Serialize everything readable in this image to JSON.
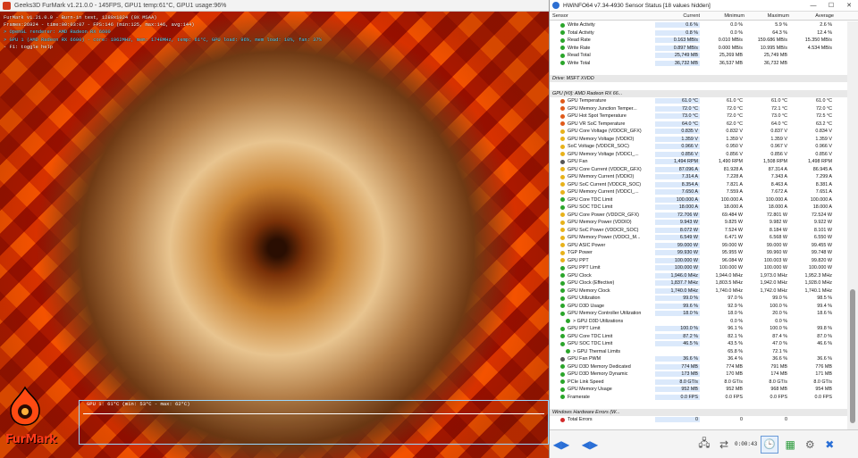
{
  "furmark": {
    "window_title": "Geeks3D FurMark v1.21.0.0 - 145FPS, GPU1 temp:61°C, GPU1 usage:96%",
    "osd": [
      {
        "text": "FurMark v1.21.0.0 - Burn-in test, 1280x1024 (0X MSAA)",
        "cls": "l-white"
      },
      {
        "text": "Frames:26924 - time:00:03:07 - FPS:146 (min:125, max:146, avg:144)",
        "cls": "l-white"
      },
      {
        "text": "> OpenGL renderer: AMD Radeon RX 6600",
        "cls": "l-cyan"
      },
      {
        "text": "> GPU 1 (AMD Radeon RX 6600) - core: 1962MHz, mem: 1748MHz, temp: 61°C, GPU load: 96%, mem load: 10%, fan: 37%",
        "cls": "l-cyan"
      },
      {
        "text": "- F1: toggle help",
        "cls": "l-white"
      }
    ],
    "graph_caption": "GPU 1: 61°C (min: 53°C - max: 62°C)",
    "logo_text": "FurMark"
  },
  "hwinfo": {
    "window_title": "HWiNFO64 v7.34-4930 Sensor Status [18 values hidden]",
    "columns": {
      "sensor": "Sensor",
      "current": "Current",
      "minimum": "Minimum",
      "maximum": "Maximum",
      "average": "Average"
    },
    "rows": [
      {
        "type": "sensor",
        "icon": "#2aa52a",
        "name": "Write Activity",
        "cur": "0.6 %",
        "min": "0.0 %",
        "max": "5.9 %",
        "avg": "2.6 %"
      },
      {
        "type": "sensor",
        "icon": "#2aa52a",
        "name": "Total Activity",
        "cur": "0.8 %",
        "min": "0.0 %",
        "max": "64.3 %",
        "avg": "12.4 %"
      },
      {
        "type": "sensor",
        "icon": "#2aa52a",
        "name": "Read Rate",
        "cur": "0.163 MB/s",
        "min": "0.010 MB/s",
        "max": "159.686 MB/s",
        "avg": "15.350 MB/s"
      },
      {
        "type": "sensor",
        "icon": "#2aa52a",
        "name": "Write Rate",
        "cur": "0.897 MB/s",
        "min": "0.000 MB/s",
        "max": "10.995 MB/s",
        "avg": "4.534 MB/s"
      },
      {
        "type": "sensor",
        "icon": "#2aa52a",
        "name": "Read Total",
        "cur": "25,749 MB",
        "min": "25,269 MB",
        "max": "25,749 MB",
        "avg": ""
      },
      {
        "type": "sensor",
        "icon": "#2aa52a",
        "name": "Write Total",
        "cur": "36,732 MB",
        "min": "36,537 MB",
        "max": "36,732 MB",
        "avg": ""
      },
      {
        "type": "spacer"
      },
      {
        "type": "group",
        "name": "Drive: MSFT XVDD"
      },
      {
        "type": "spacer"
      },
      {
        "type": "group",
        "name": "GPU [#0]: AMD Radeon RX 66..."
      },
      {
        "type": "sensor",
        "icon": "#e05a1a",
        "name": "GPU Temperature",
        "cur": "61.0 °C",
        "min": "61.0 °C",
        "max": "61.0 °C",
        "avg": "61.0 °C"
      },
      {
        "type": "sensor",
        "icon": "#e05a1a",
        "name": "GPU Memory Junction Temper...",
        "cur": "72.0 °C",
        "min": "72.0 °C",
        "max": "72.1 °C",
        "avg": "72.0 °C"
      },
      {
        "type": "sensor",
        "icon": "#e05a1a",
        "name": "GPU Hot Spot Temperature",
        "cur": "73.0 °C",
        "min": "72.0 °C",
        "max": "73.0 °C",
        "avg": "72.5 °C"
      },
      {
        "type": "sensor",
        "icon": "#e05a1a",
        "name": "GPU VR SoC Temperature",
        "cur": "64.0 °C",
        "min": "62.0 °C",
        "max": "64.0 °C",
        "avg": "63.2 °C"
      },
      {
        "type": "sensor",
        "icon": "#e8b21a",
        "name": "GPU Core Voltage (VDDCR_GFX)",
        "cur": "0.835 V",
        "min": "0.832 V",
        "max": "0.837 V",
        "avg": "0.834 V"
      },
      {
        "type": "sensor",
        "icon": "#e8b21a",
        "name": "GPU Memory Voltage (VDDIO)",
        "cur": "1.359 V",
        "min": "1.359 V",
        "max": "1.359 V",
        "avg": "1.359 V"
      },
      {
        "type": "sensor",
        "icon": "#e8b21a",
        "name": "SoC Voltage (VDDCR_SOC)",
        "cur": "0.966 V",
        "min": "0.950 V",
        "max": "0.967 V",
        "avg": "0.966 V"
      },
      {
        "type": "sensor",
        "icon": "#e8b21a",
        "name": "GPU Memory Voltage (VDDCI_...",
        "cur": "0.856 V",
        "min": "0.856 V",
        "max": "0.856 V",
        "avg": "0.856 V"
      },
      {
        "type": "sensor",
        "icon": "#555555",
        "name": "GPU Fan",
        "cur": "1,494 RPM",
        "min": "1,490 RPM",
        "max": "1,508 RPM",
        "avg": "1,498 RPM"
      },
      {
        "type": "sensor",
        "icon": "#e8b21a",
        "name": "GPU Core Current (VDDCR_GFX)",
        "cur": "87.096 A",
        "min": "81.928 A",
        "max": "87.314 A",
        "avg": "86.945 A"
      },
      {
        "type": "sensor",
        "icon": "#e8b21a",
        "name": "GPU Memory Current (VDDIO)",
        "cur": "7.314 A",
        "min": "7.228 A",
        "max": "7.343 A",
        "avg": "7.299 A"
      },
      {
        "type": "sensor",
        "icon": "#e8b21a",
        "name": "GPU SoC Current (VDDCR_SOC)",
        "cur": "8.354 A",
        "min": "7.821 A",
        "max": "8.463 A",
        "avg": "8.381 A"
      },
      {
        "type": "sensor",
        "icon": "#e8b21a",
        "name": "GPU Memory Current (VDDCI_...",
        "cur": "7.650 A",
        "min": "7.559 A",
        "max": "7.672 A",
        "avg": "7.651 A"
      },
      {
        "type": "sensor",
        "icon": "#2aa52a",
        "name": "GPU Core TDC Limit",
        "cur": "100.000 A",
        "min": "100.000 A",
        "max": "100.000 A",
        "avg": "100.000 A"
      },
      {
        "type": "sensor",
        "icon": "#2aa52a",
        "name": "GPU SOC TDC Limit",
        "cur": "18.000 A",
        "min": "18.000 A",
        "max": "18.000 A",
        "avg": "18.000 A"
      },
      {
        "type": "sensor",
        "icon": "#e8b21a",
        "name": "GPU Core Power (VDDCR_GFX)",
        "cur": "72.706 W",
        "min": "69.484 W",
        "max": "72.801 W",
        "avg": "72.524 W"
      },
      {
        "type": "sensor",
        "icon": "#e8b21a",
        "name": "GPU Memory Power (VDDIO)",
        "cur": "9.943 W",
        "min": "9.825 W",
        "max": "9.982 W",
        "avg": "9.922 W"
      },
      {
        "type": "sensor",
        "icon": "#e8b21a",
        "name": "GPU SoC Power (VDDCR_SOC)",
        "cur": "8.072 W",
        "min": "7.524 W",
        "max": "8.184 W",
        "avg": "8.101 W"
      },
      {
        "type": "sensor",
        "icon": "#e8b21a",
        "name": "GPU Memory Power (VDDCI_M...",
        "cur": "6.549 W",
        "min": "6.471 W",
        "max": "6.568 W",
        "avg": "6.550 W"
      },
      {
        "type": "sensor",
        "icon": "#e8b21a",
        "name": "GPU ASIC Power",
        "cur": "99.000 W",
        "min": "99.000 W",
        "max": "99.000 W",
        "avg": "99.455 W"
      },
      {
        "type": "sensor",
        "icon": "#e8b21a",
        "name": "TGP Power",
        "cur": "99.930 W",
        "min": "95.955 W",
        "max": "99.960 W",
        "avg": "99.748 W"
      },
      {
        "type": "sensor",
        "icon": "#e8b21a",
        "name": "GPU PPT",
        "cur": "100.000 W",
        "min": "96.084 W",
        "max": "100.003 W",
        "avg": "99.820 W"
      },
      {
        "type": "sensor",
        "icon": "#2aa52a",
        "name": "GPU PPT Limit",
        "cur": "100.000 W",
        "min": "100.000 W",
        "max": "100.000 W",
        "avg": "100.000 W"
      },
      {
        "type": "sensor",
        "icon": "#2aa52a",
        "name": "GPU Clock",
        "cur": "1,946.0 MHz",
        "min": "1,944.0 MHz",
        "max": "1,973.0 MHz",
        "avg": "1,952.3 MHz"
      },
      {
        "type": "sensor",
        "icon": "#2aa52a",
        "name": "GPU Clock (Effective)",
        "cur": "1,837.7 MHz",
        "min": "1,803.5 MHz",
        "max": "1,942.0 MHz",
        "avg": "1,928.0 MHz"
      },
      {
        "type": "sensor",
        "icon": "#2aa52a",
        "name": "GPU Memory Clock",
        "cur": "1,740.0 MHz",
        "min": "1,740.0 MHz",
        "max": "1,742.0 MHz",
        "avg": "1,740.1 MHz"
      },
      {
        "type": "sensor",
        "icon": "#2aa52a",
        "name": "GPU Utilization",
        "cur": "99.0 %",
        "min": "97.0 %",
        "max": "99.0 %",
        "avg": "98.5 %"
      },
      {
        "type": "sensor",
        "icon": "#2aa52a",
        "name": "GPU D3D Usage",
        "cur": "99.6 %",
        "min": "92.9 %",
        "max": "100.0 %",
        "avg": "99.4 %"
      },
      {
        "type": "sensor",
        "icon": "#2aa52a",
        "name": "GPU Memory Controller Utilization",
        "cur": "18.0 %",
        "min": "18.0 %",
        "max": "20.0 %",
        "avg": "18.6 %"
      },
      {
        "type": "sensor",
        "sub": true,
        "icon": "#2aa52a",
        "name": "> GPU D3D Utilizations",
        "cur": "",
        "min": "0.0 %",
        "max": "0.0 %",
        "avg": ""
      },
      {
        "type": "sensor",
        "icon": "#2aa52a",
        "name": "GPU PPT Limit",
        "cur": "100.0 %",
        "min": "96.1 %",
        "max": "100.0 %",
        "avg": "99.8 %"
      },
      {
        "type": "sensor",
        "icon": "#2aa52a",
        "name": "GPU Core TDC Limit",
        "cur": "87.2 %",
        "min": "82.1 %",
        "max": "87.4 %",
        "avg": "87.0 %"
      },
      {
        "type": "sensor",
        "icon": "#2aa52a",
        "name": "GPU SOC TDC Limit",
        "cur": "46.5 %",
        "min": "43.5 %",
        "max": "47.0 %",
        "avg": "46.6 %"
      },
      {
        "type": "sensor",
        "sub": true,
        "icon": "#2aa52a",
        "name": "> GPU Thermal Limits",
        "cur": "",
        "min": "65.8 %",
        "max": "72.1 %",
        "avg": ""
      },
      {
        "type": "sensor",
        "icon": "#555555",
        "name": "GPU Fan PWM",
        "cur": "36.6 %",
        "min": "36.4 %",
        "max": "36.6 %",
        "avg": "36.6 %"
      },
      {
        "type": "sensor",
        "icon": "#2aa52a",
        "name": "GPU D3D Memory Dedicated",
        "cur": "774 MB",
        "min": "774 MB",
        "max": "791 MB",
        "avg": "776 MB"
      },
      {
        "type": "sensor",
        "icon": "#2aa52a",
        "name": "GPU D3D Memory Dynamic",
        "cur": "173 MB",
        "min": "170 MB",
        "max": "174 MB",
        "avg": "171 MB"
      },
      {
        "type": "sensor",
        "icon": "#2aa52a",
        "name": "PCIe Link Speed",
        "cur": "8.0 GT/s",
        "min": "8.0 GT/s",
        "max": "8.0 GT/s",
        "avg": "8.0 GT/s"
      },
      {
        "type": "sensor",
        "icon": "#2aa52a",
        "name": "GPU Memory Usage",
        "cur": "952 MB",
        "min": "952 MB",
        "max": "968 MB",
        "avg": "954 MB"
      },
      {
        "type": "sensor",
        "icon": "#2aa52a",
        "name": "Framerate",
        "cur": "0.0 FPS",
        "min": "0.0 FPS",
        "max": "0.0 FPS",
        "avg": "0.0 FPS"
      },
      {
        "type": "spacer"
      },
      {
        "type": "group",
        "name": "Windows Hardware Errors (W..."
      },
      {
        "type": "sensor",
        "icon": "#d22a2a",
        "name": "Total Errors",
        "cur": "0",
        "min": "0",
        "max": "0",
        "avg": ""
      }
    ],
    "footer": {
      "timer": "0:00:43"
    }
  }
}
